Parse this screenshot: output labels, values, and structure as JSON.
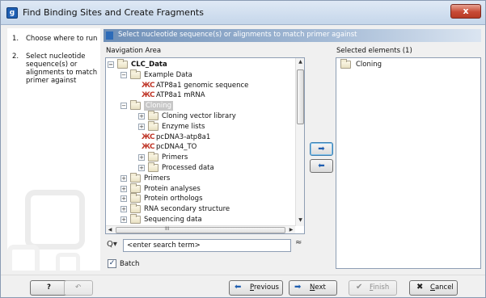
{
  "window": {
    "title": "Find Binding Sites and Create Fragments",
    "app_icon_letter": "g",
    "close_glyph": "x"
  },
  "steps": [
    {
      "num": "1.",
      "label": "Choose where to run"
    },
    {
      "num": "2.",
      "label": "Select nucleotide sequence(s) or alignments to match primer against"
    }
  ],
  "header": {
    "text": "Select nucleotide sequence(s) or alignments to match primer against"
  },
  "navigation": {
    "label": "Navigation Area",
    "tree": [
      {
        "label": "CLC_Data",
        "icon": "folder-icon",
        "expander": "−",
        "bold": true
      },
      {
        "label": "Example Data",
        "icon": "folder-icon",
        "expander": "−"
      },
      {
        "label": "ATP8a1 genomic sequence",
        "icon": "sequence-icon"
      },
      {
        "label": "ATP8a1 mRNA",
        "icon": "sequence-icon"
      },
      {
        "label": "Cloning",
        "icon": "folder-icon",
        "expander": "−",
        "selected": true
      },
      {
        "label": "Cloning vector library",
        "icon": "folder-icon",
        "expander": "+"
      },
      {
        "label": "Enzyme lists",
        "icon": "folder-icon",
        "expander": "+"
      },
      {
        "label": "pcDNA3-atp8a1",
        "icon": "sequence-icon"
      },
      {
        "label": "pcDNA4_TO",
        "icon": "sequence-icon"
      },
      {
        "label": "Primers",
        "icon": "folder-icon",
        "expander": "+"
      },
      {
        "label": "Processed data",
        "icon": "folder-icon",
        "expander": "+"
      },
      {
        "label": "Primers",
        "icon": "folder-icon",
        "expander": "+"
      },
      {
        "label": "Protein analyses",
        "icon": "folder-icon",
        "expander": "+"
      },
      {
        "label": "Protein orthologs",
        "icon": "folder-icon",
        "expander": "+"
      },
      {
        "label": "RNA secondary structure",
        "icon": "folder-icon",
        "expander": "+"
      },
      {
        "label": "Sequencing data",
        "icon": "folder-icon",
        "expander": "+"
      }
    ],
    "sequence_glyph": "ЖС",
    "scroll_up": "▲",
    "scroll_down": "▼",
    "scroll_left": "◀",
    "scroll_right": "▶",
    "hscroll_grip": "III",
    "vscroll_grip": "≡"
  },
  "search": {
    "icon": "search-icon",
    "icon_glyph": "Q▾",
    "placeholder": "<enter search term>",
    "toggle_glyph": "≈"
  },
  "batch": {
    "label": "Batch",
    "checked": true,
    "check_glyph": "✓"
  },
  "move_buttons": {
    "add_glyph": "➡",
    "remove_glyph": "⬅"
  },
  "selected": {
    "label": "Selected elements (1)",
    "items": [
      {
        "label": "Cloning",
        "icon": "folder-icon"
      }
    ]
  },
  "footer": {
    "help_glyph": "?",
    "reset_glyph": "↶",
    "previous": {
      "prefix": "",
      "accel": "P",
      "rest": "revious",
      "glyph": "⬅"
    },
    "next": {
      "accel": "N",
      "rest": "ext",
      "glyph": "➡"
    },
    "finish": {
      "accel": "F",
      "rest": "inish",
      "glyph": "✔"
    },
    "cancel": {
      "accel": "C",
      "rest": "ancel",
      "glyph": "✖"
    }
  }
}
